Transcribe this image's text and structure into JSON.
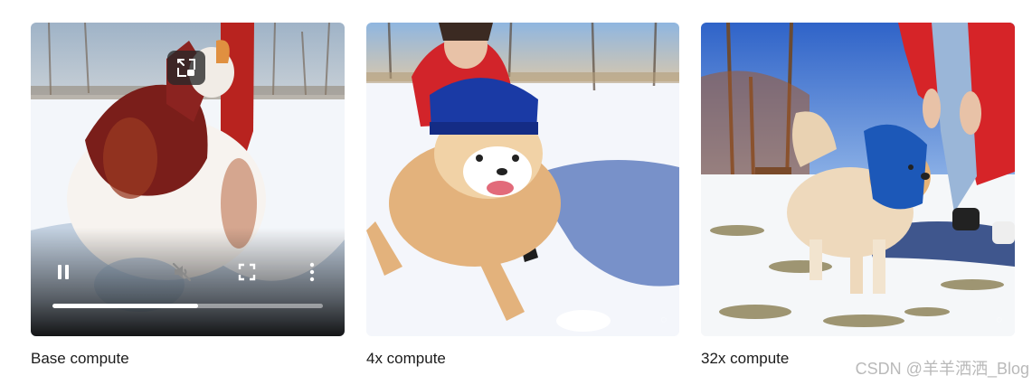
{
  "tiles": [
    {
      "caption": "Base compute",
      "has_video_controls": true,
      "progress_fraction": 0.54
    },
    {
      "caption": "4x compute",
      "has_video_controls": false
    },
    {
      "caption": "32x compute",
      "has_video_controls": false
    }
  ],
  "controls": {
    "icons": [
      "picture-in-picture-icon",
      "pause-icon",
      "volume-muted-icon",
      "fullscreen-icon",
      "more-vertical-icon"
    ]
  },
  "watermark": {
    "text": "CSDN @羊羊洒洒_Blog"
  },
  "colors": {
    "caption_text": "#1b1b1b",
    "controls_white": "#ffffff",
    "watermark_gray": "#b9b9b9"
  }
}
